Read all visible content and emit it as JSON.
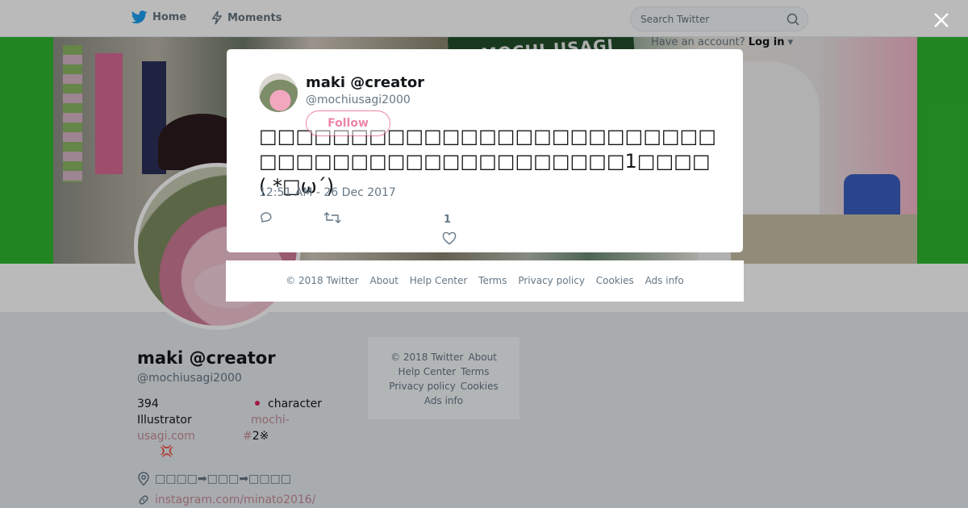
{
  "nav": {
    "home_label": "Home",
    "moments_label": "Moments",
    "search_placeholder": "Search Twitter",
    "account_prompt": "Have an account?",
    "login_label": "Log in"
  },
  "banner": {
    "sign_text": "MOCHI-USAGI"
  },
  "profile": {
    "name": "maki @creator",
    "handle": "@mochiusagi2000",
    "bio": {
      "count": "394",
      "character": "character",
      "role": "Illustrator",
      "site_part1": "mochi-",
      "site_part2": "usagi.com",
      "hash": "#",
      "num": "2※",
      "emoji": "💢"
    },
    "location": "□□□□➡□□□➡□□□□",
    "url": "instagram.com/minato2016/"
  },
  "side_footer": {
    "copyright": "© 2018 Twitter",
    "about": "About",
    "help": "Help Center",
    "terms": "Terms",
    "privacy": "Privacy policy",
    "cookies": "Cookies",
    "ads": "Ads info"
  },
  "modal": {
    "name": "maki @creator",
    "handle": "@mochiusagi2000",
    "follow_label": "Follow",
    "tweet_text": "□□□□□□□□□□□□□□□□□□□□□□□□□□□□□□□□□□□□□□□□□□□□□1□□□□ ( *□ω´)",
    "timestamp": "12:51 AM - 26 Dec 2017",
    "like_count": "1"
  },
  "modal_footer": {
    "copyright": "© 2018 Twitter",
    "about": "About",
    "help": "Help Center",
    "terms": "Terms",
    "privacy": "Privacy policy",
    "cookies": "Cookies",
    "ads": "Ads info"
  },
  "colors": {
    "link": "#c98d99",
    "accent": "#e0245e",
    "banner_green": "#2eb82e",
    "twitter_blue": "#1da1f2"
  },
  "icons": [
    "twitter-bird-icon",
    "lightning-icon",
    "search-icon",
    "close-icon",
    "reply-icon",
    "retweet-icon",
    "heart-icon",
    "location-icon",
    "link-icon"
  ]
}
